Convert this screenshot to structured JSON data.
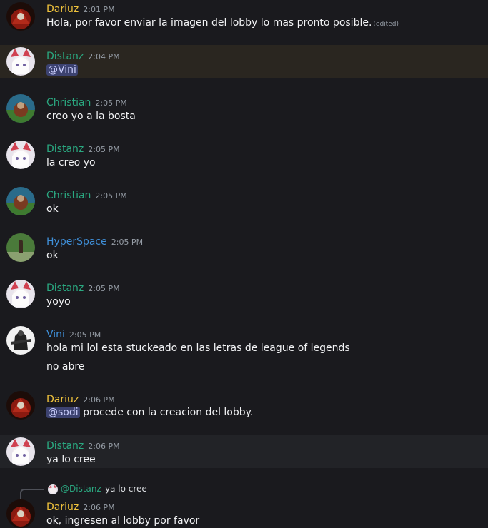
{
  "messages": [
    {
      "author": "Dariuz",
      "time": "2:01 PM",
      "text": "Hola, por favor enviar la imagen del lobby lo mas pronto posible.",
      "edited": "(edited)"
    },
    {
      "author": "Distanz",
      "time": "2:04 PM",
      "mention": "@Vini"
    },
    {
      "author": "Christian",
      "time": "2:05 PM",
      "text": "creo yo a la bosta"
    },
    {
      "author": "Distanz",
      "time": "2:05 PM",
      "text": "la creo yo"
    },
    {
      "author": "Christian",
      "time": "2:05 PM",
      "text": "ok"
    },
    {
      "author": "HyperSpace",
      "time": "2:05 PM",
      "text": "ok"
    },
    {
      "author": "Distanz",
      "time": "2:05 PM",
      "text": "yoyo"
    },
    {
      "author": "Vini",
      "time": "2:05 PM",
      "text": "hola mi lol esta stuckeado en las letras de league of legends",
      "text2": "no abre"
    },
    {
      "author": "Dariuz",
      "time": "2:06 PM",
      "mention": "@sodi",
      "text": "procede con la creacion del lobby."
    },
    {
      "author": "Distanz",
      "time": "2:06 PM",
      "text": "ya lo cree"
    },
    {
      "author": "Dariuz",
      "time": "2:06 PM",
      "text": "ok, ingresen al lobby por favor",
      "reply_author": "@Distanz",
      "reply_text": "ya lo cree"
    }
  ],
  "colors": {
    "background": "#1a1a1e",
    "Dariuz": "#f0c33c",
    "Distanz": "#2aa880",
    "Christian": "#2aa880",
    "HyperSpace": "#3f8fd8",
    "Vini": "#3f8fd8",
    "mention_bg": "#3c4270"
  }
}
